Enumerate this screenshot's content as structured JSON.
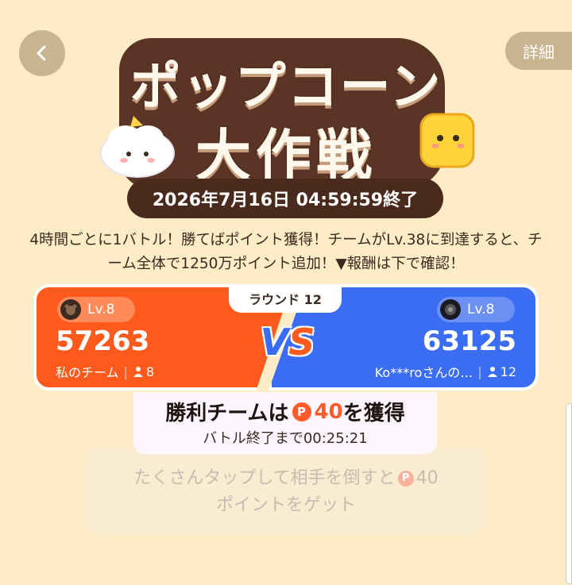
{
  "header": {
    "back_icon": "chevron-left-icon",
    "detail_label": "詳細"
  },
  "title": {
    "line1": "ポップコーン",
    "line2": "大作戦",
    "end_time": "2026年7月16日 04:59:59終了"
  },
  "description": "4時間ごとに1バトル！勝てばポイント獲得！チームがLv.38に到達すると、チーム全体で1250万ポイント追加！▼報酬は下で確認！",
  "battle": {
    "round": "ラウンド 12",
    "vs_v": "V",
    "vs_s": "S",
    "left": {
      "level": "Lv.8",
      "score": "57263",
      "name": "私のチーム",
      "members": "8",
      "color": "#ff5a1e"
    },
    "right": {
      "level": "Lv.8",
      "score": "63125",
      "name": "Ko***roさんの…",
      "members": "12",
      "color": "#3a6df2"
    }
  },
  "reward": {
    "prefix": "勝利チームは",
    "coin_symbol": "P",
    "amount": "40",
    "suffix": "を獲得",
    "countdown": "バトル終了まで00:25:21"
  },
  "tap_hint": {
    "line1_prefix": "たくさんタップして相手を倒すと",
    "coin_symbol": "P",
    "amount": "40",
    "line2": "ポイントをゲット"
  }
}
